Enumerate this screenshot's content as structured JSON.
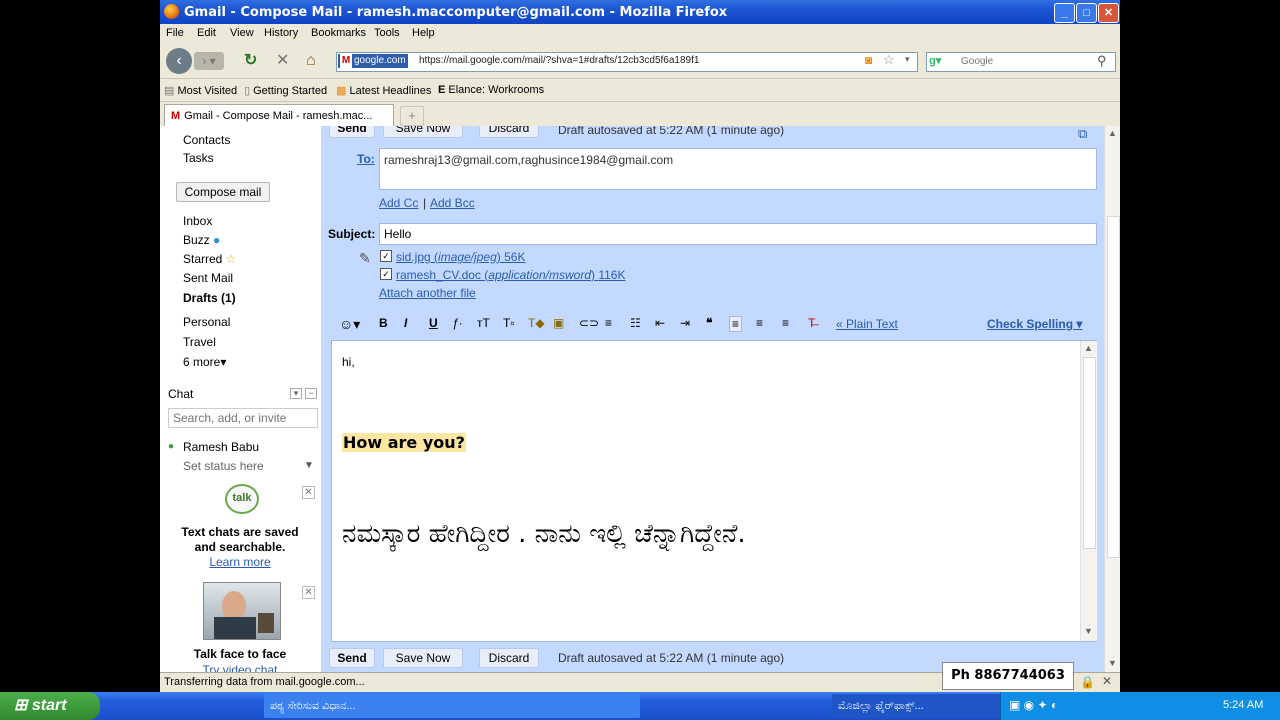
{
  "window": {
    "title": "Gmail - Compose Mail - ramesh.maccomputer@gmail.com - Mozilla Firefox",
    "min": "_",
    "max": "□",
    "close": "✕"
  },
  "menu": [
    "File",
    "Edit",
    "View",
    "History",
    "Bookmarks",
    "Tools",
    "Help"
  ],
  "nav": {
    "url_site": "google.com",
    "url": "https://mail.google.com/mail/?shva=1#drafts/12cb3cd5f6a189f1",
    "search_placeholder": "Google"
  },
  "bookmarks": [
    "Most Visited",
    "Getting Started",
    "Latest Headlines",
    "Elance: Workrooms"
  ],
  "tab": {
    "label": "Gmail - Compose Mail - ramesh.mac...",
    "new": "+"
  },
  "sidebar": {
    "contacts": "Contacts",
    "tasks": "Tasks",
    "compose": "Compose mail",
    "inbox": "Inbox",
    "buzz": "Buzz",
    "starred": "Starred",
    "sent": "Sent Mail",
    "drafts": "Drafts (1)",
    "personal": "Personal",
    "travel": "Travel",
    "more": "6 more▾",
    "chat_title": "Chat",
    "chat_search_placeholder": "Search, add, or invite",
    "user": "Ramesh Babu",
    "status": "Set status here",
    "talk_badge": "talk",
    "chats_saved_1": "Text chats are saved",
    "chats_saved_2": "and searchable.",
    "learn_more": "Learn more",
    "talk_face": "Talk face to face",
    "try_video": "Try video chat"
  },
  "compose": {
    "send": "Send",
    "save_now": "Save Now",
    "discard": "Discard",
    "autosaved": "Draft autosaved at 5:22 AM (1 minute ago)",
    "to_label": "To:",
    "to_value": "rameshraj13@gmail.com,raghusince1984@gmail.com",
    "add_cc": "Add Cc",
    "separator": "|",
    "add_bcc": "Add Bcc",
    "subject_label": "Subject:",
    "subject_value": "Hello",
    "attachments": [
      {
        "name": "sid.jpg",
        "type": "image/jpeg",
        "size": "56K"
      },
      {
        "name": "ramesh_CV.doc",
        "type": "application/msword",
        "size": "116K"
      }
    ],
    "attach_another": "Attach another file",
    "plain_text": "« Plain Text",
    "check_spelling": "Check Spelling ▾",
    "body_line1": "hi,",
    "body_line2": "How are you?",
    "body_line3": "ನಮಸ್ಕಾರ ಹೇಗಿದ್ದೀರ . ನಾನು ಇಲ್ಲಿ ಚೆನ್ನಾಗಿದ್ದೇನೆ."
  },
  "status_text": "Transferring data from mail.google.com...",
  "phone_overlay": "Ph 8867744063",
  "taskbar": {
    "start": "start",
    "task1": "ಪಠ್ಯ ಸೇರಿಸುವ ವಿಧಾನ...",
    "task2": "ಮೊಜಿಲ್ಲಾ ಫೈರ್‌ಫಾಕ್ಸ್...",
    "clock": "5:24 AM"
  },
  "colors": {
    "gmail_blue": "#c3d9ff",
    "xp_title": "#0f44c4",
    "link": "#2a5db0"
  }
}
